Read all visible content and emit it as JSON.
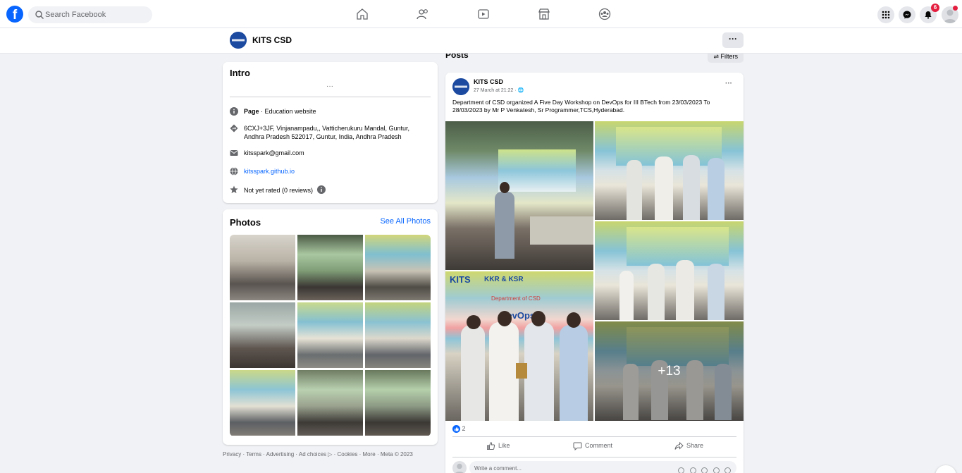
{
  "topbar": {
    "search_placeholder": "Search Facebook",
    "logo_letter": "f",
    "notification_count": "6",
    "nav_icons": [
      "home-icon",
      "friends-icon",
      "video-icon",
      "marketplace-icon",
      "groups-icon"
    ]
  },
  "page_header": {
    "name": "KITS CSD",
    "more_label": "···"
  },
  "intro": {
    "title": "Intro",
    "more_label": "···",
    "category_label": "Page",
    "category_value": " · Education website",
    "address": "6CXJ+3JF, Vinjanampadu,, Vatticherukuru Mandal, Guntur, Andhra Pradesh 522017, Guntur, India, Andhra Pradesh",
    "email": "kitsspark@gmail.com",
    "website": "kitsspark.github.io",
    "rating": "Not yet rated (0 reviews)"
  },
  "photos": {
    "title": "Photos",
    "see_all": "See All Photos"
  },
  "footer": {
    "text": "Privacy · Terms · Advertising · Ad choices ▷ · Cookies · More · Meta © 2023"
  },
  "posts": {
    "title": "Posts",
    "filters": "⇌ Filters"
  },
  "post": {
    "author": "KITS CSD",
    "time": "27 March at 21:22 · 🌐",
    "text": "Department of CSD organized A Five Day Workshop on DevOps for III BTech from 23/03/2023 To 28/03/2023 by Mr P Venkatesh, Sr Programmer,TCS,Hyderabad.",
    "more_photos": "+13",
    "reaction_count": "2",
    "like_label": "Like",
    "comment_label": "Comment",
    "share_label": "Share",
    "comment_placeholder": "Write a comment...",
    "banner_lines": [
      "KITS",
      "KKR & KSR",
      "Department of CSD",
      "DevOps"
    ]
  },
  "colors": {
    "brand": "#0866ff",
    "page_bg": "#f0f2f5",
    "badge": "#e41e3f"
  }
}
